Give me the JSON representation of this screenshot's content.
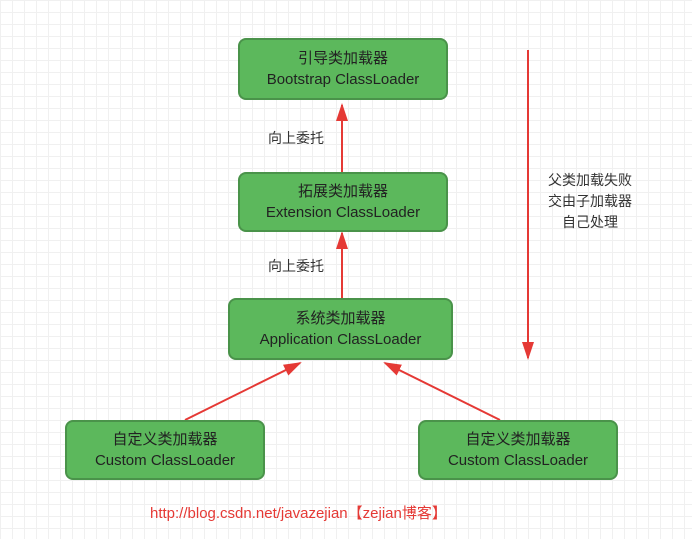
{
  "boxes": {
    "bootstrap": {
      "cn": "引导类加载器",
      "en": "Bootstrap ClassLoader"
    },
    "extension": {
      "cn": "拓展类加载器",
      "en": "Extension ClassLoader"
    },
    "application": {
      "cn": "系统类加载器",
      "en": "Application ClassLoader"
    },
    "custom1": {
      "cn": "自定义类加载器",
      "en": "Custom ClassLoader"
    },
    "custom2": {
      "cn": "自定义类加载器",
      "en": "Custom ClassLoader"
    }
  },
  "labels": {
    "delegate1": "向上委托",
    "delegate2": "向上委托",
    "sideNote": {
      "l1": "父类加载失败",
      "l2": "交由子加载器",
      "l3": "自己处理"
    }
  },
  "footer": {
    "url": "http://blog.csdn.net/javazejian",
    "blog": "【zejian博客】"
  }
}
